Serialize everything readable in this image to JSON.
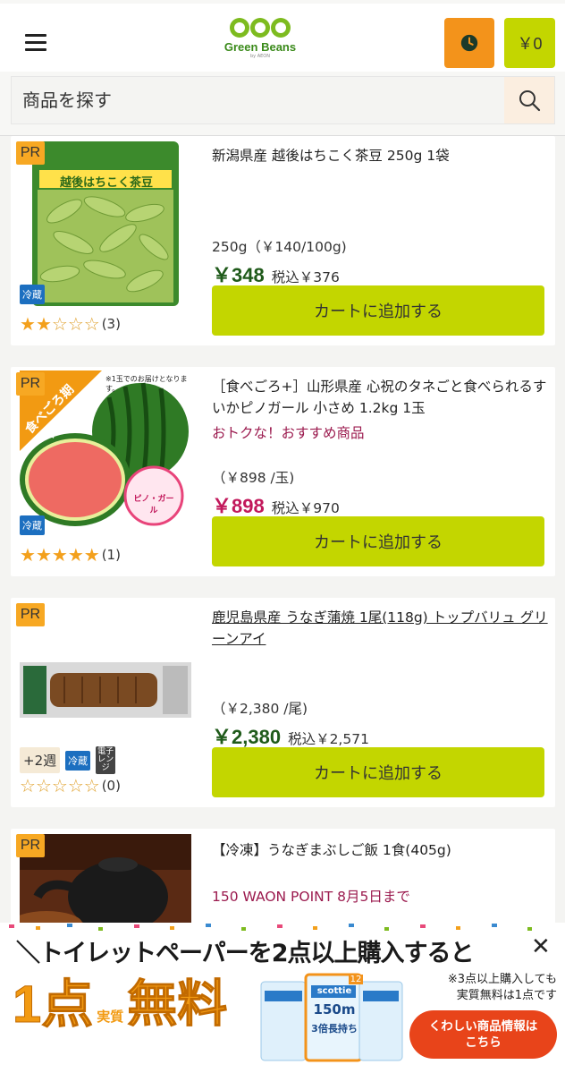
{
  "header": {
    "logo_text": "Green Beans",
    "logo_byline": "by AEON",
    "cart_total": "￥0",
    "search_placeholder": "商品を探す"
  },
  "products": [
    {
      "pr": "PR",
      "title": "新潟県産 越後はちこく茶豆 250g 1袋",
      "promo": "",
      "unit": "250g（￥140/100g)",
      "price": "￥348",
      "tax_in": "税込￥376",
      "rating": 2,
      "rating_max": 5,
      "review_count": "(3)",
      "badges": {
        "weeks": "",
        "cold": "冷蔵",
        "micro": ""
      },
      "add_label": "カートに追加する",
      "image_caption": "越後はちこく茶豆"
    },
    {
      "pr": "PR",
      "title": "［食べごろ+］山形県産 心祝のタネごと食べられるすいかピノガール 小さめ 1.2kg 1玉",
      "promo": "おトクな！おすすめ商品",
      "unit": "（￥898 /玉)",
      "price": "￥898",
      "tax_in": "税込￥970",
      "rating": 5,
      "rating_max": 5,
      "review_count": "(1)",
      "badges": {
        "weeks": "",
        "cold": "冷蔵",
        "micro": ""
      },
      "add_label": "カートに追加する",
      "image_caption": "※1玉でのお届けとなります。",
      "image_ribbon": "食べごろ期間保証",
      "image_sticker": "ピノ・ガール"
    },
    {
      "pr": "PR",
      "title": "鹿児島県産 うなぎ蒲焼 1尾(118g) トップバリュ グリーンアイ",
      "promo": "",
      "unit": "（￥2,380 /尾)",
      "price": "￥2,380",
      "tax_in": "税込￥2,571",
      "rating": 0,
      "rating_max": 5,
      "review_count": "(0)",
      "badges": {
        "weeks": "+2週",
        "cold": "冷蔵",
        "micro": "電子レンジ"
      },
      "add_label": "カートに追加する",
      "image_caption": ""
    },
    {
      "pr": "PR",
      "title": "【冷凍】うなぎまぶしご飯 1食(405g)",
      "promo": "150 WAON POINT 8月5日まで",
      "unit": "",
      "price": "",
      "tax_in": "",
      "rating": 0,
      "rating_max": 5,
      "review_count": "",
      "badges": {
        "weeks": "",
        "cold": "",
        "micro": ""
      },
      "add_label": "",
      "image_caption": ""
    }
  ],
  "banner": {
    "headline": "＼トイレットペーパーを2点以上購入すると",
    "close": "✕",
    "big_1": "1点",
    "big_jitsu": "実質",
    "big_free": "無料",
    "product_brand": "scottie",
    "product_length": "150m",
    "product_sub": "3倍長持ち",
    "product_pack": "12",
    "note_line1": "※3点以上購入しても",
    "note_line2": "実質無料は1点です",
    "detail_line1": "くわしい商品情報は",
    "detail_line2": "こちら"
  },
  "colors": {
    "accent_green": "#c3d600",
    "brand_green": "#3a8a1a",
    "clock_orange": "#f3931b",
    "pr_orange": "#f7a823",
    "price_green": "#1f5a1a",
    "price_red": "#c2185b",
    "promo_magenta": "#9b1a4e",
    "badge_blue": "#1c6fc0"
  },
  "icons": [
    "menu-icon",
    "clock-icon",
    "search-icon",
    "star-icon",
    "close-icon"
  ]
}
